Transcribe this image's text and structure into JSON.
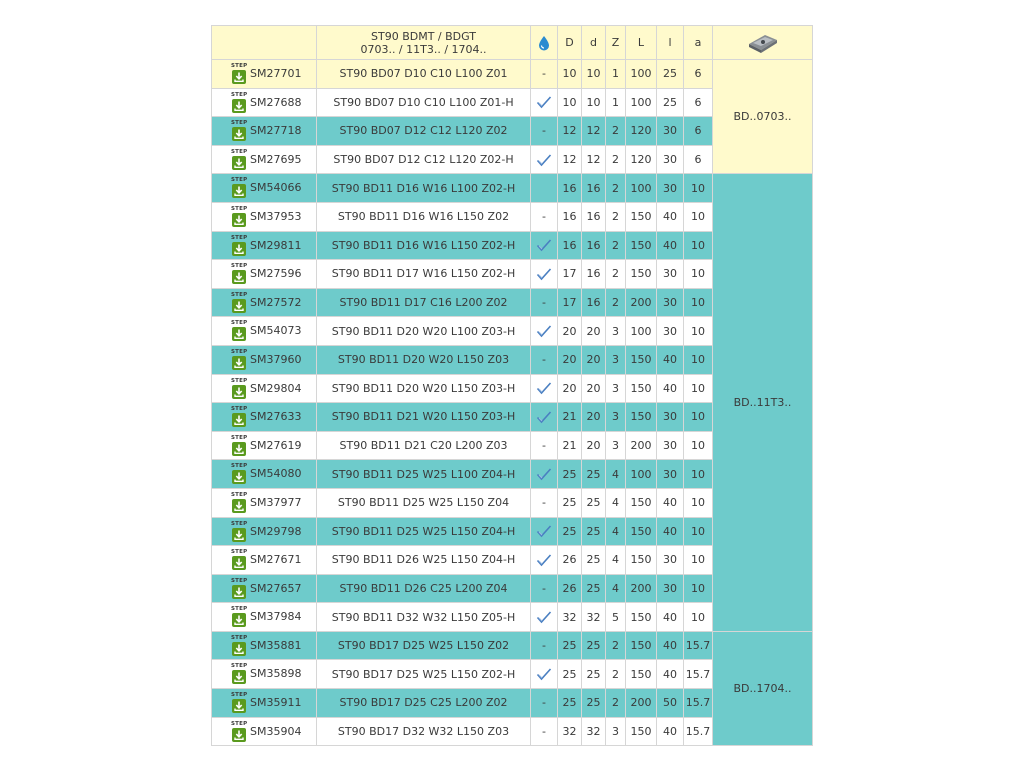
{
  "header": {
    "desc_line1": "ST90 BDMT / BDGT",
    "desc_line2": "0703.. / 11T3.. / 1704..",
    "coolant_icon": "water-drop-icon",
    "col_D": "D",
    "col_d": "d",
    "col_Z": "Z",
    "col_L": "L",
    "col_l": "l",
    "col_a": "a",
    "insert_icon": "insert-image-icon"
  },
  "step_label": "STEP",
  "step_icon": "download-icon",
  "check_icon": "checkmark-icon",
  "colors": {
    "teal": "#6ecbcb",
    "cream": "#fffacc",
    "green": "#5a9a1e",
    "check": "#4a7fc1"
  },
  "groups": [
    "BD..0703..",
    "BD..11T3..",
    "BD..1704.."
  ],
  "rows": [
    {
      "code": "SM27701",
      "desc": "ST90 BD07 D10 C10 L100 Z01",
      "coolant": "-",
      "D": "10",
      "d": "10",
      "Z": "1",
      "L": "100",
      "l": "25",
      "a": "6",
      "bg": "yellow"
    },
    {
      "code": "SM27688",
      "desc": "ST90 BD07 D10 C10 L100 Z01-H",
      "coolant": "check",
      "D": "10",
      "d": "10",
      "Z": "1",
      "L": "100",
      "l": "25",
      "a": "6",
      "bg": "white"
    },
    {
      "code": "SM27718",
      "desc": "ST90 BD07 D12 C12 L120 Z02",
      "coolant": "-",
      "D": "12",
      "d": "12",
      "Z": "2",
      "L": "120",
      "l": "30",
      "a": "6",
      "bg": "teal"
    },
    {
      "code": "SM27695",
      "desc": "ST90 BD07 D12 C12 L120 Z02-H",
      "coolant": "check",
      "D": "12",
      "d": "12",
      "Z": "2",
      "L": "120",
      "l": "30",
      "a": "6",
      "bg": "white"
    },
    {
      "code": "SM54066",
      "desc": "ST90 BD11 D16 W16 L100 Z02-H",
      "coolant": "",
      "D": "16",
      "d": "16",
      "Z": "2",
      "L": "100",
      "l": "30",
      "a": "10",
      "bg": "teal"
    },
    {
      "code": "SM37953",
      "desc": "ST90 BD11 D16 W16 L150 Z02",
      "coolant": "-",
      "D": "16",
      "d": "16",
      "Z": "2",
      "L": "150",
      "l": "40",
      "a": "10",
      "bg": "white"
    },
    {
      "code": "SM29811",
      "desc": "ST90 BD11 D16 W16 L150 Z02-H",
      "coolant": "check",
      "D": "16",
      "d": "16",
      "Z": "2",
      "L": "150",
      "l": "40",
      "a": "10",
      "bg": "teal"
    },
    {
      "code": "SM27596",
      "desc": "ST90 BD11 D17 W16 L150 Z02-H",
      "coolant": "check",
      "D": "17",
      "d": "16",
      "Z": "2",
      "L": "150",
      "l": "30",
      "a": "10",
      "bg": "white"
    },
    {
      "code": "SM27572",
      "desc": "ST90 BD11 D17 C16 L200 Z02",
      "coolant": "-",
      "D": "17",
      "d": "16",
      "Z": "2",
      "L": "200",
      "l": "30",
      "a": "10",
      "bg": "teal"
    },
    {
      "code": "SM54073",
      "desc": "ST90 BD11 D20 W20 L100 Z03-H",
      "coolant": "check",
      "D": "20",
      "d": "20",
      "Z": "3",
      "L": "100",
      "l": "30",
      "a": "10",
      "bg": "white"
    },
    {
      "code": "SM37960",
      "desc": "ST90 BD11 D20 W20 L150 Z03",
      "coolant": "-",
      "D": "20",
      "d": "20",
      "Z": "3",
      "L": "150",
      "l": "40",
      "a": "10",
      "bg": "teal"
    },
    {
      "code": "SM29804",
      "desc": "ST90 BD11 D20 W20 L150 Z03-H",
      "coolant": "check",
      "D": "20",
      "d": "20",
      "Z": "3",
      "L": "150",
      "l": "40",
      "a": "10",
      "bg": "white"
    },
    {
      "code": "SM27633",
      "desc": "ST90 BD11 D21 W20 L150 Z03-H",
      "coolant": "check",
      "D": "21",
      "d": "20",
      "Z": "3",
      "L": "150",
      "l": "30",
      "a": "10",
      "bg": "teal"
    },
    {
      "code": "SM27619",
      "desc": "ST90 BD11 D21 C20 L200 Z03",
      "coolant": "-",
      "D": "21",
      "d": "20",
      "Z": "3",
      "L": "200",
      "l": "30",
      "a": "10",
      "bg": "white"
    },
    {
      "code": "SM54080",
      "desc": "ST90 BD11 D25 W25 L100 Z04-H",
      "coolant": "check",
      "D": "25",
      "d": "25",
      "Z": "4",
      "L": "100",
      "l": "30",
      "a": "10",
      "bg": "teal"
    },
    {
      "code": "SM37977",
      "desc": "ST90 BD11 D25 W25 L150 Z04",
      "coolant": "-",
      "D": "25",
      "d": "25",
      "Z": "4",
      "L": "150",
      "l": "40",
      "a": "10",
      "bg": "white"
    },
    {
      "code": "SM29798",
      "desc": "ST90 BD11 D25 W25 L150 Z04-H",
      "coolant": "check",
      "D": "25",
      "d": "25",
      "Z": "4",
      "L": "150",
      "l": "40",
      "a": "10",
      "bg": "teal"
    },
    {
      "code": "SM27671",
      "desc": "ST90 BD11 D26 W25 L150 Z04-H",
      "coolant": "check",
      "D": "26",
      "d": "25",
      "Z": "4",
      "L": "150",
      "l": "30",
      "a": "10",
      "bg": "white"
    },
    {
      "code": "SM27657",
      "desc": "ST90 BD11 D26 C25 L200 Z04",
      "coolant": "-",
      "D": "26",
      "d": "25",
      "Z": "4",
      "L": "200",
      "l": "30",
      "a": "10",
      "bg": "teal"
    },
    {
      "code": "SM37984",
      "desc": "ST90 BD11 D32 W32 L150 Z05-H",
      "coolant": "check",
      "D": "32",
      "d": "32",
      "Z": "5",
      "L": "150",
      "l": "40",
      "a": "10",
      "bg": "white"
    },
    {
      "code": "SM35881",
      "desc": "ST90 BD17 D25 W25 L150 Z02",
      "coolant": "-",
      "D": "25",
      "d": "25",
      "Z": "2",
      "L": "150",
      "l": "40",
      "a": "15.7",
      "bg": "teal"
    },
    {
      "code": "SM35898",
      "desc": "ST90 BD17 D25 W25 L150 Z02-H",
      "coolant": "check",
      "D": "25",
      "d": "25",
      "Z": "2",
      "L": "150",
      "l": "40",
      "a": "15.7",
      "bg": "white"
    },
    {
      "code": "SM35911",
      "desc": "ST90 BD17 D25 C25 L200 Z02",
      "coolant": "-",
      "D": "25",
      "d": "25",
      "Z": "2",
      "L": "200",
      "l": "50",
      "a": "15.7",
      "bg": "teal"
    },
    {
      "code": "SM35904",
      "desc": "ST90 BD17 D32 W32 L150 Z03",
      "coolant": "-",
      "D": "32",
      "d": "32",
      "Z": "3",
      "L": "150",
      "l": "40",
      "a": "15.7",
      "bg": "white"
    }
  ]
}
